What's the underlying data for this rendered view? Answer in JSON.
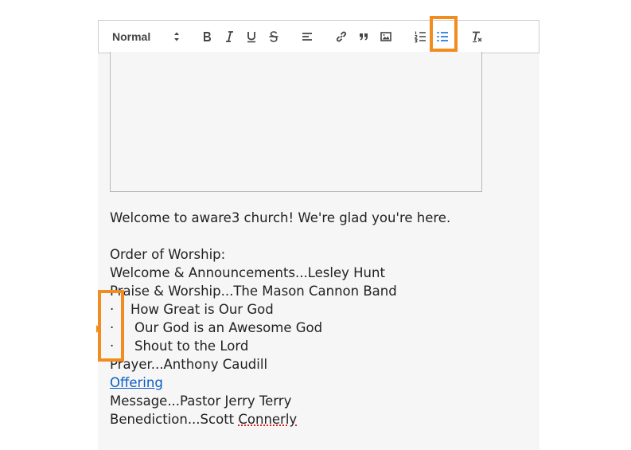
{
  "toolbar": {
    "format_select": "Normal",
    "buttons": [
      {
        "name": "bold-button",
        "icon": "bold-icon"
      },
      {
        "name": "italic-button",
        "icon": "italic-icon"
      },
      {
        "name": "underline-button",
        "icon": "underline-icon"
      },
      {
        "name": "strike-button",
        "icon": "strikethrough-icon"
      },
      {
        "name": "align-button",
        "icon": "align-left-icon"
      },
      {
        "name": "link-button",
        "icon": "link-icon"
      },
      {
        "name": "blockquote-button",
        "icon": "quote-icon"
      },
      {
        "name": "image-button",
        "icon": "image-icon"
      },
      {
        "name": "ordered-list-button",
        "icon": "ordered-list-icon"
      },
      {
        "name": "bullet-list-button",
        "icon": "bullet-list-icon",
        "active": true
      },
      {
        "name": "clear-format-button",
        "icon": "clear-format-icon"
      }
    ],
    "active_color": "#0066cc"
  },
  "highlight_color": "#f28c1e",
  "content": {
    "welcome": "Welcome to aware3 church! We're glad you're here.",
    "order_heading": "Order of Worship:",
    "line1": "Welcome & Announcements...Lesley Hunt",
    "line2": "Praise & Worship...The Mason Cannon Band",
    "bullet_char": "·",
    "bullets": [
      "How Great is Our God",
      "Our God is an Awesome God",
      "Shout to the Lord"
    ],
    "prayer": "Prayer...Anthony Caudill",
    "offering_link": "Offering",
    "message": "Message...Pastor Jerry Terry",
    "benediction_prefix": "Benediction...Scott ",
    "benediction_misspelled": "Connerly"
  }
}
